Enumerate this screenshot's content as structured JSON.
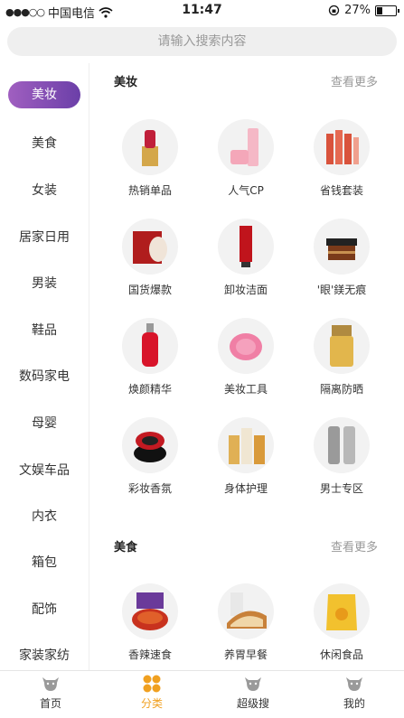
{
  "status": {
    "carrier": "中国电信",
    "time": "11:47",
    "battery": "27%",
    "battery_level": 0.27
  },
  "search": {
    "placeholder": "请输入搜索内容"
  },
  "sidebar": {
    "items": [
      {
        "label": "美妆",
        "active": true
      },
      {
        "label": "美食"
      },
      {
        "label": "女装"
      },
      {
        "label": "居家日用"
      },
      {
        "label": "男装"
      },
      {
        "label": "鞋品"
      },
      {
        "label": "数码家电"
      },
      {
        "label": "母婴"
      },
      {
        "label": "文娱车品"
      },
      {
        "label": "内衣"
      },
      {
        "label": "箱包"
      },
      {
        "label": "配饰"
      },
      {
        "label": "家装家纺"
      }
    ]
  },
  "sections": [
    {
      "title": "美妆",
      "more": "查看更多",
      "items": [
        {
          "label": "热销单品",
          "icon": "lipstick-icon"
        },
        {
          "label": "人气CP",
          "icon": "cream-bottles-icon"
        },
        {
          "label": "省钱套装",
          "icon": "skincare-set-icon"
        },
        {
          "label": "国货爆款",
          "icon": "face-mask-icon"
        },
        {
          "label": "卸妆洁面",
          "icon": "cleanser-tube-icon"
        },
        {
          "label": "'眼'鎂无痕",
          "icon": "eye-cream-jar-icon"
        },
        {
          "label": "焕颜精华",
          "icon": "serum-bottle-icon"
        },
        {
          "label": "美妆工具",
          "icon": "cleansing-brush-icon"
        },
        {
          "label": "隔离防晒",
          "icon": "sunscreen-icon"
        },
        {
          "label": "彩妆香氛",
          "icon": "cushion-compact-icon"
        },
        {
          "label": "身体护理",
          "icon": "body-oil-icon"
        },
        {
          "label": "男士专区",
          "icon": "mens-bottles-icon"
        }
      ]
    },
    {
      "title": "美食",
      "more": "查看更多",
      "items": [
        {
          "label": "香辣速食",
          "icon": "spicy-food-icon"
        },
        {
          "label": "养胃早餐",
          "icon": "bread-icon"
        },
        {
          "label": "休闲食品",
          "icon": "snack-bag-icon"
        }
      ]
    }
  ],
  "tabs": [
    {
      "label": "首页",
      "icon": "cow-icon"
    },
    {
      "label": "分类",
      "icon": "category-icon",
      "active": true
    },
    {
      "label": "超级搜",
      "icon": "cow-icon"
    },
    {
      "label": "我的",
      "icon": "cow-icon"
    }
  ],
  "colors": {
    "accent": "#7b49b0",
    "tab_active": "#f0a020"
  }
}
